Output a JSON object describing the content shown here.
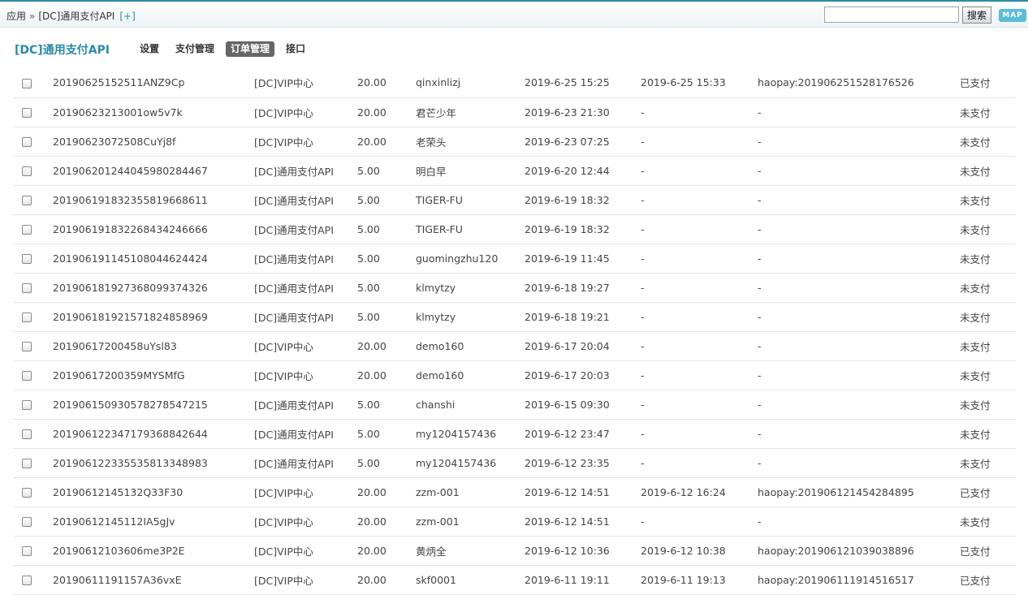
{
  "breadcrumb": {
    "root": "应用",
    "separator": "»",
    "current": "[DC]通用支付API",
    "add": "[+]"
  },
  "search": {
    "value": "",
    "button_label": "搜索",
    "map_label": "MAP"
  },
  "app": {
    "title": "[DC]通用支付API",
    "tabs": [
      {
        "label": "设置",
        "active": false
      },
      {
        "label": "支付管理",
        "active": false
      },
      {
        "label": "订单管理",
        "active": true
      },
      {
        "label": "接口",
        "active": false
      }
    ]
  },
  "orders": [
    {
      "order_no": "20190625152511ANZ9Cp",
      "app": "[DC]VIP中心",
      "amount": "20.00",
      "user": "qinxinlizj",
      "created": "2019-6-25 15:25",
      "paid_time": "2019-6-25 15:33",
      "trade_no": "haopay:201906251528176526",
      "status": "已支付"
    },
    {
      "order_no": "20190623213001ow5v7k",
      "app": "[DC]VIP中心",
      "amount": "20.00",
      "user": "君芒少年",
      "created": "2019-6-23 21:30",
      "paid_time": "-",
      "trade_no": "-",
      "status": "未支付"
    },
    {
      "order_no": "20190623072508CuYj8f",
      "app": "[DC]VIP中心",
      "amount": "20.00",
      "user": "老荣头",
      "created": "2019-6-23 07:25",
      "paid_time": "-",
      "trade_no": "-",
      "status": "未支付"
    },
    {
      "order_no": "20190620124404598028446 7",
      "app": "[DC]通用支付API",
      "amount": "5.00",
      "user": "明白早",
      "created": "2019-6-20 12:44",
      "paid_time": "-",
      "trade_no": "-",
      "status": "未支付"
    },
    {
      "order_no": "201906191832355819668611",
      "app": "[DC]通用支付API",
      "amount": "5.00",
      "user": "TIGER-FU",
      "created": "2019-6-19 18:32",
      "paid_time": "-",
      "trade_no": "-",
      "status": "未支付"
    },
    {
      "order_no": "201906191832268434246666",
      "app": "[DC]通用支付API",
      "amount": "5.00",
      "user": "TIGER-FU",
      "created": "2019-6-19 18:32",
      "paid_time": "-",
      "trade_no": "-",
      "status": "未支付"
    },
    {
      "order_no": "201906191145108044624424",
      "app": "[DC]通用支付API",
      "amount": "5.00",
      "user": "guomingzhu120",
      "created": "2019-6-19 11:45",
      "paid_time": "-",
      "trade_no": "-",
      "status": "未支付"
    },
    {
      "order_no": "201906181927368099374326",
      "app": "[DC]通用支付API",
      "amount": "5.00",
      "user": "klmytzy",
      "created": "2019-6-18 19:27",
      "paid_time": "-",
      "trade_no": "-",
      "status": "未支付"
    },
    {
      "order_no": "201906181921571824858969",
      "app": "[DC]通用支付API",
      "amount": "5.00",
      "user": "klmytzy",
      "created": "2019-6-18 19:21",
      "paid_time": "-",
      "trade_no": "-",
      "status": "未支付"
    },
    {
      "order_no": "20190617200458uYsl83",
      "app": "[DC]VIP中心",
      "amount": "20.00",
      "user": "demo160",
      "created": "2019-6-17 20:04",
      "paid_time": "-",
      "trade_no": "-",
      "status": "未支付"
    },
    {
      "order_no": "20190617200359MYSMfG",
      "app": "[DC]VIP中心",
      "amount": "20.00",
      "user": "demo160",
      "created": "2019-6-17 20:03",
      "paid_time": "-",
      "trade_no": "-",
      "status": "未支付"
    },
    {
      "order_no": "201906150930578278547215",
      "app": "[DC]通用支付API",
      "amount": "5.00",
      "user": "chanshi",
      "created": "2019-6-15 09:30",
      "paid_time": "-",
      "trade_no": "-",
      "status": "未支付"
    },
    {
      "order_no": "201906122347179368842644",
      "app": "[DC]通用支付API",
      "amount": "5.00",
      "user": "my1204157436",
      "created": "2019-6-12 23:47",
      "paid_time": "-",
      "trade_no": "-",
      "status": "未支付"
    },
    {
      "order_no": "201906122335535813348983",
      "app": "[DC]通用支付API",
      "amount": "5.00",
      "user": "my1204157436",
      "created": "2019-6-12 23:35",
      "paid_time": "-",
      "trade_no": "-",
      "status": "未支付"
    },
    {
      "order_no": "20190612145132Q33F30",
      "app": "[DC]VIP中心",
      "amount": "20.00",
      "user": "zzm-001",
      "created": "2019-6-12 14:51",
      "paid_time": "2019-6-12 16:24",
      "trade_no": "haopay:201906121454284895",
      "status": "已支付"
    },
    {
      "order_no": "20190612145112IA5gJv",
      "app": "[DC]VIP中心",
      "amount": "20.00",
      "user": "zzm-001",
      "created": "2019-6-12 14:51",
      "paid_time": "-",
      "trade_no": "-",
      "status": "未支付"
    },
    {
      "order_no": "20190612103606me3P2E",
      "app": "[DC]VIP中心",
      "amount": "20.00",
      "user": "黄炳全",
      "created": "2019-6-12 10:36",
      "paid_time": "2019-6-12 10:38",
      "trade_no": "haopay:201906121039038896",
      "status": "已支付"
    },
    {
      "order_no": "20190611191157A36vxE",
      "app": "[DC]VIP中心",
      "amount": "20.00",
      "user": "skf0001",
      "created": "2019-6-11 19:11",
      "paid_time": "2019-6-11 19:13",
      "trade_no": "haopay:201906111914516517",
      "status": "已支付"
    }
  ]
}
